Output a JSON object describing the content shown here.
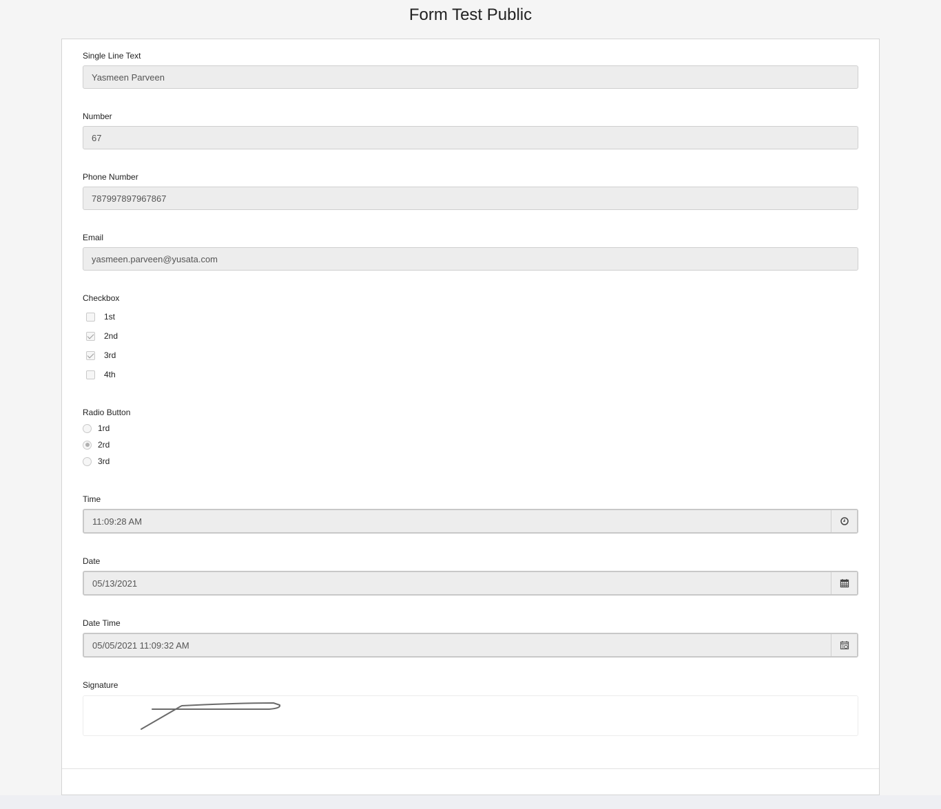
{
  "page": {
    "title": "Form Test Public"
  },
  "fields": {
    "single_line": {
      "label": "Single Line Text",
      "value": "Yasmeen Parveen"
    },
    "number": {
      "label": "Number",
      "value": "67"
    },
    "phone": {
      "label": "Phone Number",
      "value": "787997897967867"
    },
    "email": {
      "label": "Email",
      "value": "yasmeen.parveen@yusata.com"
    },
    "checkbox": {
      "label": "Checkbox",
      "options": [
        {
          "label": "1st",
          "checked": false
        },
        {
          "label": "2nd",
          "checked": true
        },
        {
          "label": "3rd",
          "checked": true
        },
        {
          "label": "4th",
          "checked": false
        }
      ]
    },
    "radio": {
      "label": "Radio Button",
      "options": [
        {
          "label": "1rd",
          "selected": false
        },
        {
          "label": "2rd",
          "selected": true
        },
        {
          "label": "3rd",
          "selected": false
        }
      ]
    },
    "time": {
      "label": "Time",
      "value": "11:09:28 AM",
      "icon": "clock-icon"
    },
    "date": {
      "label": "Date",
      "value": "05/13/2021",
      "icon": "calendar-icon"
    },
    "datetime": {
      "label": "Date Time",
      "value": "05/05/2021 11:09:32 AM",
      "icon": "calendar-clock-icon"
    },
    "signature": {
      "label": "Signature"
    }
  }
}
